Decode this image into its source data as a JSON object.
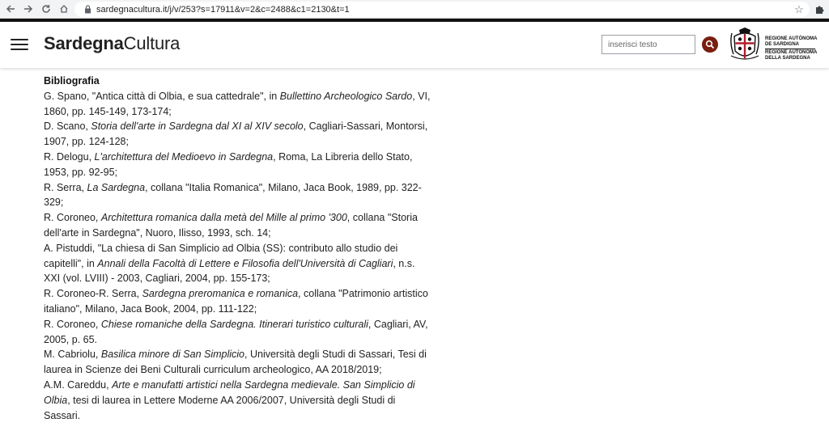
{
  "browser": {
    "url": "sardegnacultura.it/j/v/253?s=17911&v=2&c=2488&c1=2130&t=1"
  },
  "site": {
    "brand_bold": "Sardegna",
    "brand_light": "Cultura",
    "search_placeholder": "inserisci testo",
    "region_line1": "REGIONE AUTÒNOMA",
    "region_line2": "DE SARDIGNA",
    "region_line3": "REGIONE AUTONOMA",
    "region_line4": "DELLA SARDEGNA",
    "accent_color": "#7a1f0f"
  },
  "bibliography": {
    "heading": "Bibliografia",
    "entries": [
      {
        "pre": "G. Spano, \"Antica città di Olbia, e sua cattedrale\", in ",
        "it": "Bullettino Archeologico Sardo",
        "post": ", VI, 1860, pp. 145-149, 173-174;"
      },
      {
        "pre": "D. Scano, ",
        "it": "Storia dell'arte in Sardegna dal XI al XIV secolo",
        "post": ", Cagliari-Sassari, Montorsi, 1907, pp. 124-128;"
      },
      {
        "pre": "R. Delogu, ",
        "it": "L'architettura del Medioevo in Sardegna",
        "post": ", Roma, La Libreria dello Stato, 1953, pp. 92-95;"
      },
      {
        "pre": "R. Serra, ",
        "it": "La Sardegna",
        "post": ", collana \"Italia Romanica\", Milano, Jaca Book, 1989, pp. 322-329;"
      },
      {
        "pre": "R. Coroneo, ",
        "it": "Architettura romanica dalla metà del Mille al primo '300",
        "post": ", collana \"Storia dell'arte in Sardegna\", Nuoro, Ilisso, 1993, sch. 14;"
      },
      {
        "pre": "A. Pistuddi, \"La chiesa di San Simplicio ad Olbia (SS): contributo allo studio dei capitelli\", in ",
        "it": "Annali della Facoltà di Lettere e Filosofia dell'Università di Cagliari",
        "post": ", n.s. XXI (vol. LVIII) - 2003, Cagliari, 2004, pp. 155-173;"
      },
      {
        "pre": "R. Coroneo-R. Serra, ",
        "it": "Sardegna preromanica e romanica",
        "post": ", collana \"Patrimonio artistico italiano\", Milano, Jaca Book, 2004, pp. 111-122;"
      },
      {
        "pre": "R. Coroneo, ",
        "it": "Chiese romaniche della Sardegna. Itinerari turistico culturali",
        "post": ", Cagliari, AV, 2005, p. 65."
      },
      {
        "pre": "M. Cabriolu, ",
        "it": "Basilica minore di San Simplicio",
        "post": ", Università degli Studi di Sassari, Tesi di laurea in Scienze dei Beni Culturali curriculum archeologico, AA 2018/2019;"
      },
      {
        "pre": "A.M. Careddu, ",
        "it": "Arte e manufatti artistici nella Sardegna medievale. San Simplicio di Olbia",
        "post": ", tesi di laurea in Lettere Moderne AA 2006/2007, Università degli Studi di Sassari."
      }
    ]
  }
}
